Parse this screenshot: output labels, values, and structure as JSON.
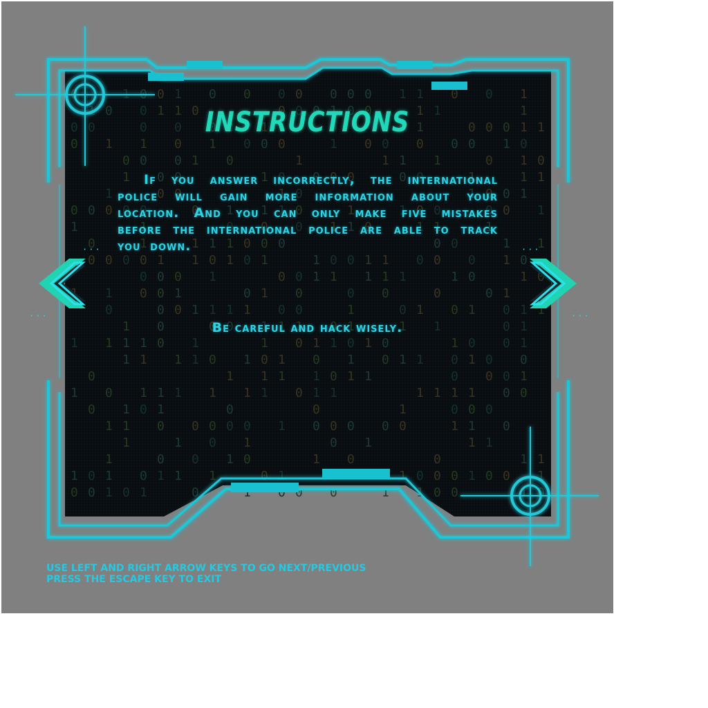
{
  "screen": {
    "title": "INSTRUCTIONS",
    "body": "If you answer incorrectly, the international police will gain more information about your location. And you can only make five mistakes before the international police are able to track you down.",
    "tagline": "Be careful and hack wisely."
  },
  "footer": {
    "line1": "USE LEFT AND RIGHT ARROW KEYS TO GO NEXT/PREVIOUS",
    "line2": "PRESS THE ESCAPE KEY TO EXIT"
  },
  "icons": {
    "prev": "chevron-left-icon",
    "next": "chevron-right-icon",
    "reticle": "crosshair-icon"
  },
  "colors": {
    "accent": "#19c6d6",
    "title": "#1fd9b9",
    "text": "#2ad4e6",
    "panel": "#0b0f12",
    "backdrop": "#808080"
  }
}
